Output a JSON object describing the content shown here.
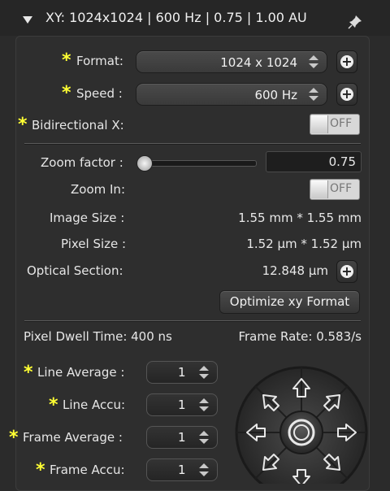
{
  "header": {
    "title": "XY: 1024x1024 | 600 Hz | 0.75 | 1.00 AU"
  },
  "format": {
    "label": "Format:",
    "value": "1024 x 1024"
  },
  "speed": {
    "label": "Speed :",
    "value": "600 Hz"
  },
  "bidirectional": {
    "label": "Bidirectional X:",
    "toggle": "OFF"
  },
  "zoom_factor": {
    "label": "Zoom factor :",
    "value": "0.75"
  },
  "zoom_in": {
    "label": "Zoom In:",
    "toggle": "OFF"
  },
  "image_size": {
    "label": "Image Size :",
    "value": "1.55 mm * 1.55 mm"
  },
  "pixel_size": {
    "label": "Pixel Size :",
    "value": "1.52 µm * 1.52 µm"
  },
  "optical_section": {
    "label": "Optical Section:",
    "value": "12.848 µm"
  },
  "optimize_button": "Optimize xy Format",
  "pixel_dwell": "Pixel Dwell Time: 400 ns",
  "frame_rate": "Frame Rate: 0.583/s",
  "averaging": {
    "line_average": {
      "label": "Line Average :",
      "value": "1"
    },
    "line_accu": {
      "label": "Line Accu:",
      "value": "1"
    },
    "frame_average": {
      "label": "Frame Average :",
      "value": "1"
    },
    "frame_accu": {
      "label": "Frame Accu:",
      "value": "1"
    }
  },
  "colors": {
    "accent_star": "#ffff33",
    "background": "#2b2b2b"
  }
}
